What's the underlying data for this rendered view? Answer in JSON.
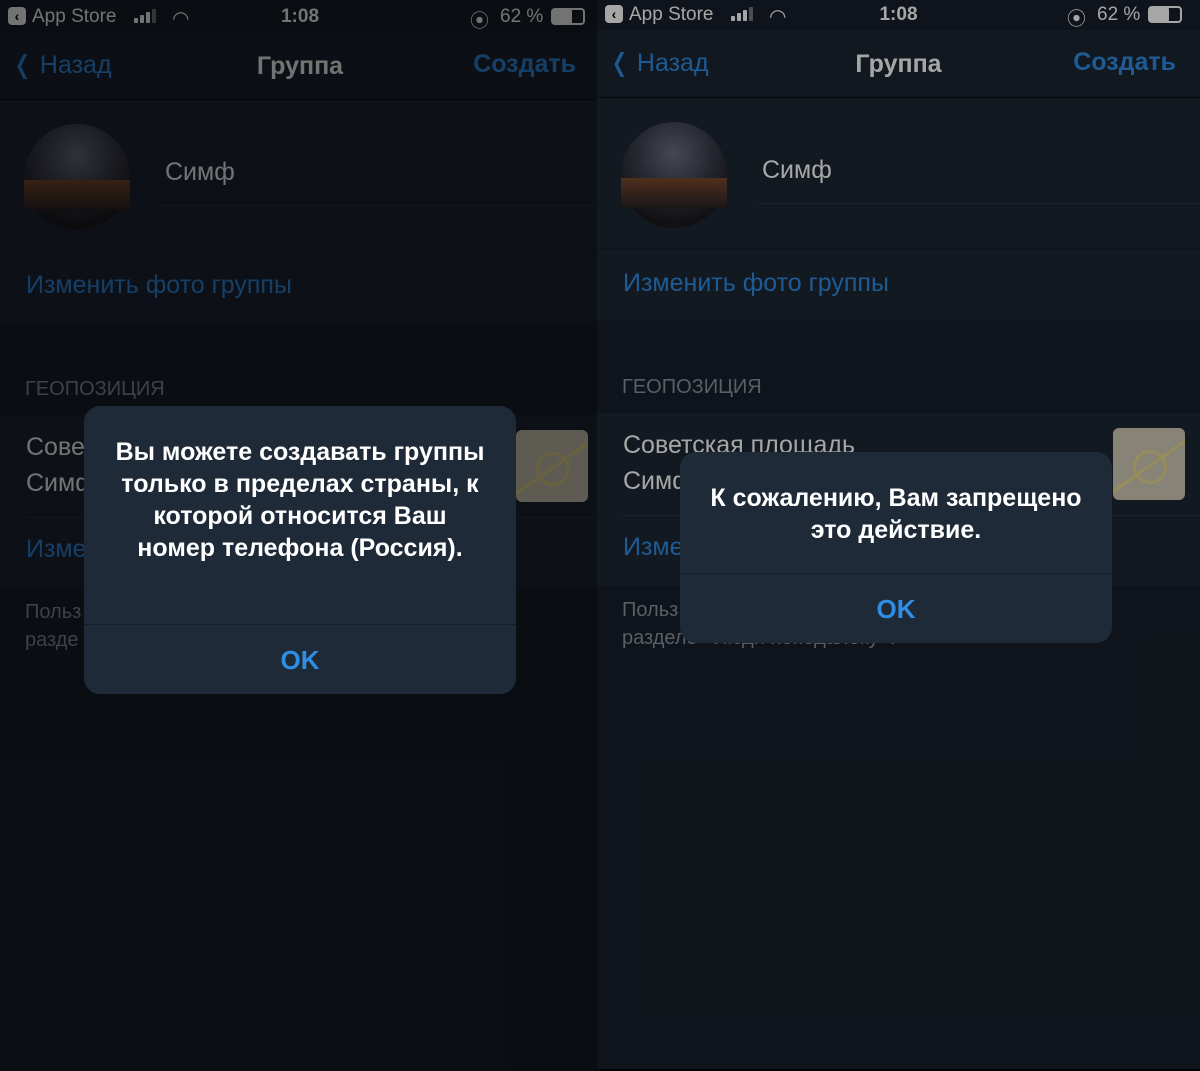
{
  "screens": [
    {
      "status": {
        "back_app": "App Store",
        "time": "1:08",
        "battery_percent": "62 %",
        "battery_level": 62
      },
      "nav": {
        "back": "Назад",
        "title": "Группа",
        "create": "Создать"
      },
      "group_name": "Симф",
      "change_photo": "Изменить фото группы",
      "location_header": "ГЕОПОЗИЦИЯ",
      "location_line1": "Советская площадь",
      "location_line2": "Симферополь",
      "change_location": "Изменить",
      "footer_line1": "Польз",
      "footer_line2": "разде",
      "dialog": {
        "message": "Вы можете создавать группы только в пределах страны, к которой относится Ваш номер телефона (Россия).",
        "ok": "OK"
      }
    },
    {
      "status": {
        "back_app": "App Store",
        "time": "1:08",
        "battery_percent": "62 %",
        "battery_level": 62
      },
      "nav": {
        "back": "Назад",
        "title": "Группа",
        "create": "Создать"
      },
      "group_name": "Симф",
      "change_photo": "Изменить фото группы",
      "location_header": "ГЕОПОЗИЦИЯ",
      "location_line1": "Советская площадь",
      "location_line2": "Симферополь",
      "change_location": "Изменить",
      "footer_line1": "Польз",
      "footer_line2": "разделе «Люди неподалёку».",
      "dialog": {
        "message": "К сожалению, Вам запрещено это действие.",
        "ok": "OK"
      }
    }
  ],
  "colors": {
    "accent": "#2f8de4",
    "background": "#18202b",
    "dialog": "#1f2a38"
  },
  "icons": [
    "back-indicator-icon",
    "signal-icon",
    "wifi-icon",
    "rotation-lock-icon",
    "battery-icon",
    "chevron-left-icon"
  ]
}
